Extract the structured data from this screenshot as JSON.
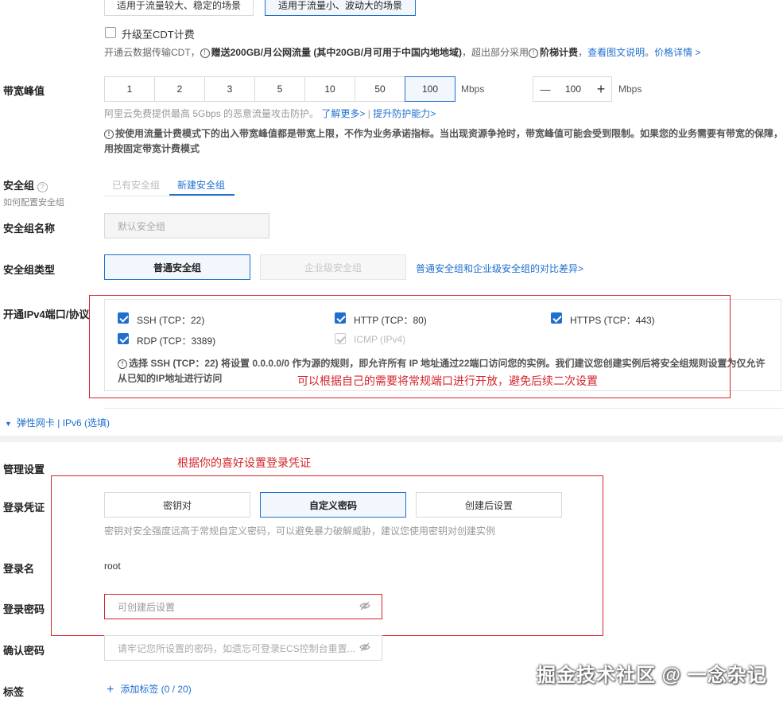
{
  "billing": {
    "option_a": "适用于流量较大、稳定的场景",
    "option_b": "适用于流量小、波动大的场景",
    "cdt_checkbox": "升级至CDT计费",
    "cdt_note_prefix": "开通云数据传输CDT，",
    "cdt_note_bold": "赠送200GB/月公网流量 (其中20GB/月可用于中国内地地域)",
    "cdt_note_mid": "，超出部分采用",
    "cdt_note_bold2": "阶梯计费",
    "cdt_note_sep": "，",
    "cdt_link_doc": "查看图文说明",
    "cdt_link_price": "价格详情 >"
  },
  "bandwidth": {
    "label": "带宽峰值",
    "options": [
      "1",
      "2",
      "3",
      "5",
      "10",
      "50",
      "100"
    ],
    "selected": "100",
    "unit": "Mbps",
    "stepper_value": "100",
    "stepper_unit": "Mbps",
    "minus": "—",
    "plus": "+",
    "ddos_note": "阿里云免费提供最高 5Gbps 的恶意流量攻击防护。",
    "link_more": "了解更多>",
    "link_sep": "|",
    "link_protect": "提升防护能力>",
    "warning_line1": "按使用流量计费模式下的出入带宽峰值都是带宽上限，不作为业务承诺指标。当出现资源争抢时，带宽峰值可能会受到限制。如果您的业务需要有带宽的保障，",
    "warning_line2": "用按固定带宽计费模式"
  },
  "security_group": {
    "label": "安全组",
    "help_link": "如何配置安全组",
    "tab_existing": "已有安全组",
    "tab_new": "新建安全组",
    "name_label": "安全组名称",
    "name_placeholder": "默认安全组",
    "type_label": "安全组类型",
    "type_normal": "普通安全组",
    "type_enterprise": "企业级安全组",
    "type_compare_link": "普通安全组和企业级安全组的对比差异>"
  },
  "ports": {
    "label": "开通IPv4端口/协议",
    "items": [
      {
        "label": "SSH (TCP：22)",
        "checked": true
      },
      {
        "label": "HTTP (TCP：80)",
        "checked": true
      },
      {
        "label": "HTTPS (TCP：443)",
        "checked": true
      },
      {
        "label": "RDP (TCP：3389)",
        "checked": true
      },
      {
        "label": "ICMP (IPv4)",
        "checked": true,
        "disabled": true
      }
    ],
    "warning_line1": "选择 SSH (TCP：22) 将设置 0.0.0.0/0 作为源的规则，即允许所有 IP 地址通过22端口访问您的实例。我们建议您创建实例后将安全组规则设置为仅允许",
    "warning_line2": "从已知的IP地址进行访问",
    "annotation": "可以根据自己的需要将常规端口进行开放，避免后续二次设置"
  },
  "eni": {
    "toggle_label": "弹性网卡 | IPv6 (选填)"
  },
  "management": {
    "section_label": "管理设置",
    "annotation": "根据你的喜好设置登录凭证",
    "credential_label": "登录凭证",
    "credential_options": [
      "密钥对",
      "自定义密码",
      "创建后设置"
    ],
    "credential_selected": "自定义密码",
    "credential_note": "密钥对安全强度远高于常规自定义密码，可以避免暴力破解威胁，建议您使用密钥对创建实例",
    "login_name_label": "登录名",
    "login_name_value": "root",
    "password_label": "登录密码",
    "password_placeholder": "可创建后设置",
    "confirm_label": "确认密码",
    "confirm_placeholder": "请牢记您所设置的密码，如遗忘可登录ECS控制台重置...",
    "tags_label": "标签",
    "add_tag": "添加标签 (0 / 20)"
  },
  "watermark": "掘金技术社区 @ 一念杂记",
  "colors": {
    "accent": "#1f6fcf",
    "annotation_red": "#d4242a"
  }
}
